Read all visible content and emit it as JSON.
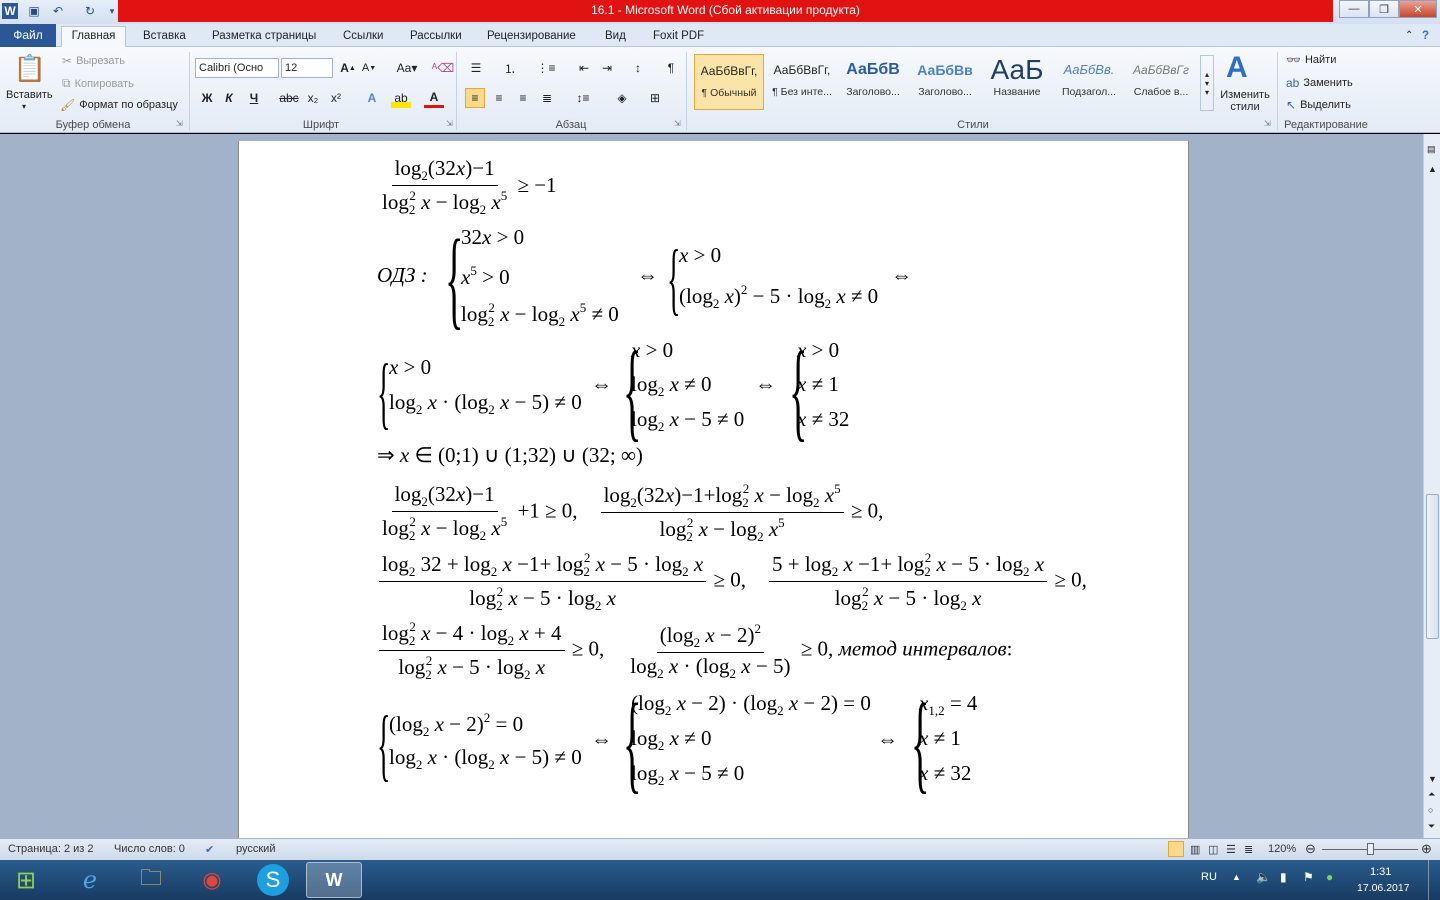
{
  "window": {
    "title": "16.1  -  Microsoft Word (Сбой активации продукта)",
    "minimize": "—",
    "maximize": "❐",
    "close": "✕"
  },
  "tabs": {
    "file": "Файл",
    "home": "Главная",
    "items": [
      "Вставка",
      "Разметка страницы",
      "Ссылки",
      "Рассылки",
      "Рецензирование",
      "Вид",
      "Foxit PDF"
    ]
  },
  "clipboard": {
    "paste": "Вставить",
    "cut": "Вырезать",
    "copy": "Копировать",
    "format_painter": "Формат по образцу",
    "group": "Буфер обмена"
  },
  "font": {
    "name": "Calibri (Осно",
    "size": "12",
    "group": "Шрифт"
  },
  "paragraph": {
    "group": "Абзац"
  },
  "styles": {
    "group": "Стили",
    "items": [
      {
        "preview": "АаБбВвГг,",
        "label": "¶ Обычный"
      },
      {
        "preview": "АаБбВвГг,",
        "label": "¶ Без инте..."
      },
      {
        "preview": "АаБбВ",
        "label": "Заголово..."
      },
      {
        "preview": "АаБбВв",
        "label": "Заголово..."
      },
      {
        "preview": "АаБ",
        "label": "Название"
      },
      {
        "preview": "АаБбВв.",
        "label": "Подзагол..."
      },
      {
        "preview": "АаБбВвГг",
        "label": "Слабое в..."
      }
    ],
    "change": "Изменить стили"
  },
  "editing": {
    "group": "Редактирование",
    "find": "Найти",
    "replace": "Заменить",
    "select": "Выделить"
  },
  "document": {
    "odz": "ОДЗ",
    "method": "метод интервалов"
  },
  "status": {
    "page": "Страница: 2 из 2",
    "words": "Число слов: 0",
    "language": "русский",
    "zoom": "120%"
  },
  "taskbar": {
    "lang": "RU",
    "time": "1:31",
    "date": "17.06.2017"
  },
  "colors": {
    "title_red": "#e01212",
    "file_tab": "#2b5797",
    "workspace": "#a2b3c9"
  }
}
